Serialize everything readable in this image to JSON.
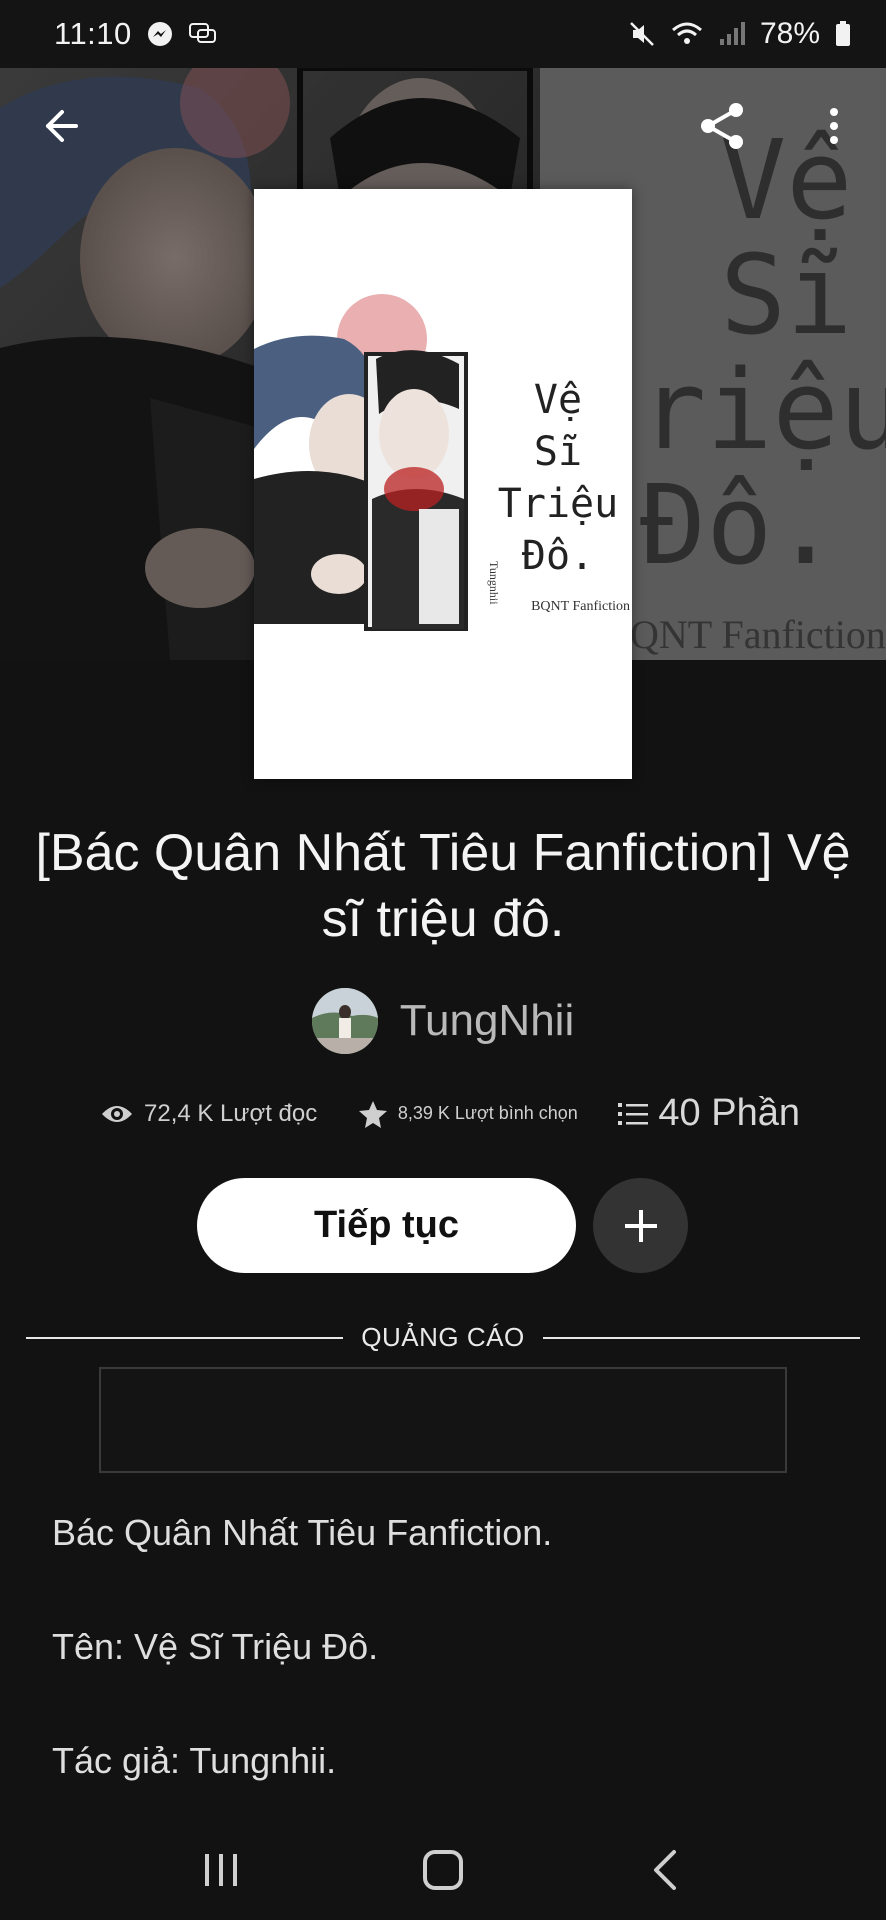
{
  "status_bar": {
    "time": "11:10",
    "battery": "78%",
    "icons": [
      "messenger-icon",
      "chat-icon",
      "mute-icon",
      "wifi-icon",
      "signal-icon",
      "battery-icon"
    ]
  },
  "header": {
    "back_icon": "arrow-left-icon",
    "share_icon": "share-icon",
    "more_icon": "more-vertical-icon"
  },
  "cover": {
    "title_lines": [
      "Vệ",
      "Sĩ",
      "Triệu",
      "Đô."
    ],
    "subtitle": "BQNT Fanfiction",
    "author_mark": "Tungnhii"
  },
  "story": {
    "title": "[Bác Quân Nhất Tiêu Fanfiction] Vệ sĩ triệu đô.",
    "author": "TungNhii"
  },
  "stats": {
    "reads": "72,4 K Lượt đọc",
    "votes": "8,39 K Lượt bình chọn",
    "parts": "40 Phần"
  },
  "actions": {
    "continue_label": "Tiếp tục",
    "add_icon": "plus-icon"
  },
  "ad": {
    "label": "QUẢNG CÁO"
  },
  "description": {
    "lines": [
      "Bác Quân Nhất Tiêu Fanfiction.",
      "Tên: Vệ Sĩ Triệu Đô.",
      "Tác giả: Tungnhii."
    ]
  },
  "nav": {
    "recents_icon": "recent-apps-icon",
    "home_icon": "home-icon",
    "back_icon": "back-chevron-icon"
  },
  "colors": {
    "background": "#121212",
    "button_primary": "#ffffff",
    "button_secondary": "#333333"
  }
}
